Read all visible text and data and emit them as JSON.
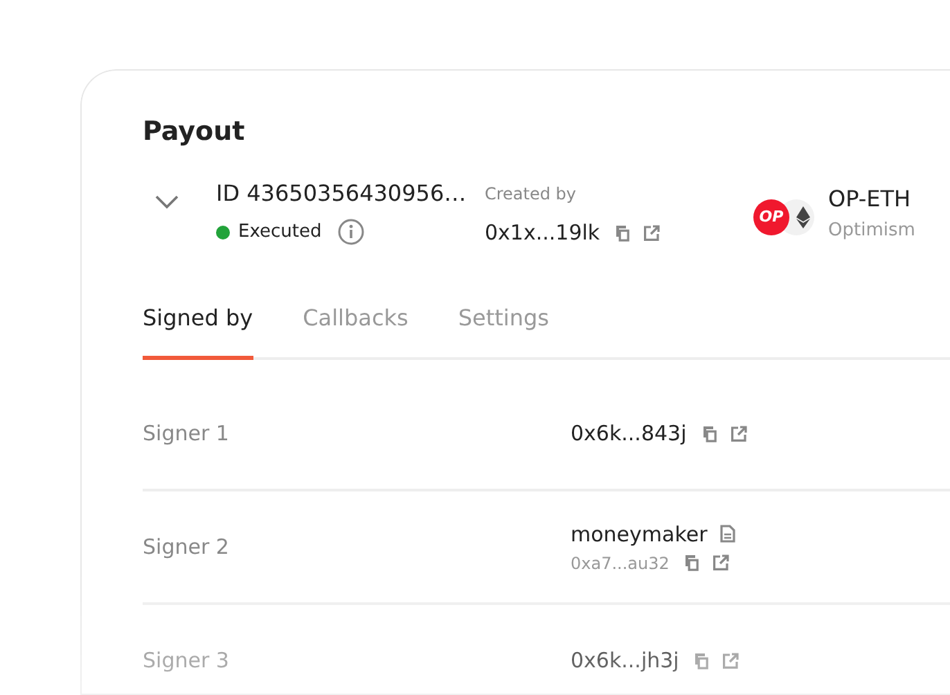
{
  "title": "Payout",
  "payout": {
    "id": "ID 43650356430956…",
    "status": "Executed",
    "created_by_label": "Created by",
    "created_by": "0x1x...19lk",
    "token": {
      "badge": "OP",
      "symbol": "OP-ETH",
      "network": "Optimism"
    }
  },
  "tabs": [
    {
      "label": "Signed by",
      "selected": true
    },
    {
      "label": "Callbacks",
      "selected": false
    },
    {
      "label": "Settings",
      "selected": false
    }
  ],
  "signers": [
    {
      "label": "Signer 1",
      "address": "0x6k...843j"
    },
    {
      "label": "Signer 2",
      "alias": "moneymaker",
      "address": "0xa7...au32"
    },
    {
      "label": "Signer 3",
      "address": "0x6k...jh3j"
    }
  ]
}
